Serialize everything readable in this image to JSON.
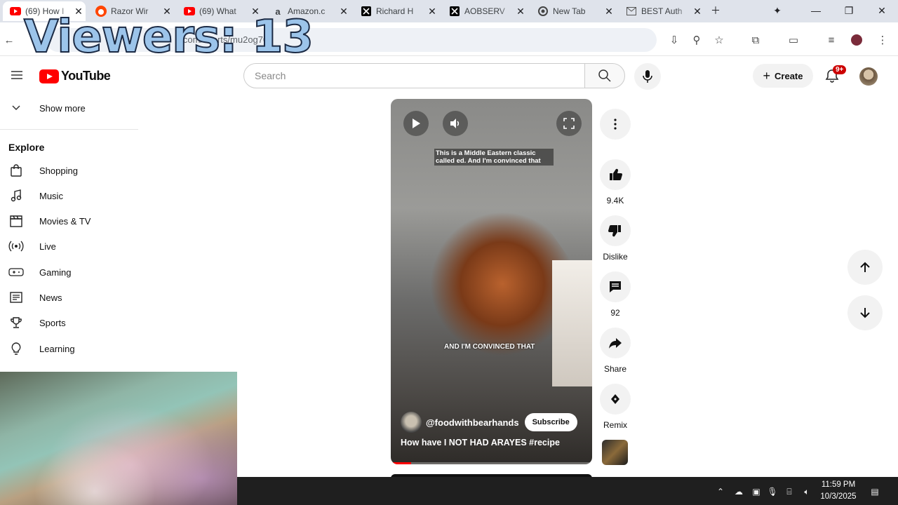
{
  "browser": {
    "tabs": [
      {
        "title": "(69) How I",
        "favicon": "youtube",
        "active": true
      },
      {
        "title": "Razor Wir",
        "favicon": "reddit",
        "active": false
      },
      {
        "title": "(69) What",
        "favicon": "youtube",
        "active": false
      },
      {
        "title": "Amazon.c",
        "favicon": "amazon",
        "active": false
      },
      {
        "title": "Richard H",
        "favicon": "x",
        "active": false
      },
      {
        "title": "AOBSERV",
        "favicon": "x",
        "active": false
      },
      {
        "title": "New Tab",
        "favicon": "chrome",
        "active": false
      },
      {
        "title": "BEST Auth",
        "favicon": "gmail",
        "active": false
      }
    ],
    "url": "e.com/shorts/mu2og70"
  },
  "overlay": {
    "viewers_text": "Viewers: 13"
  },
  "youtube": {
    "logo_text": "YouTube",
    "search_placeholder": "Search",
    "create_label": "Create",
    "notification_count": "9+",
    "sidebar": {
      "show_more": "Show more",
      "explore_title": "Explore",
      "items": [
        {
          "label": "Shopping",
          "icon": "shopping-bag-icon"
        },
        {
          "label": "Music",
          "icon": "music-note-icon"
        },
        {
          "label": "Movies & TV",
          "icon": "clapperboard-icon"
        },
        {
          "label": "Live",
          "icon": "live-broadcast-icon"
        },
        {
          "label": "Gaming",
          "icon": "gamepad-icon"
        },
        {
          "label": "News",
          "icon": "newspaper-icon"
        },
        {
          "label": "Sports",
          "icon": "trophy-icon"
        },
        {
          "label": "Learning",
          "icon": "lightbulb-icon"
        }
      ]
    },
    "short": {
      "caption_top": "This is a Middle Eastern classic called ed. And I'm convinced that",
      "caption_mid": "AND I'M CONVINCED THAT",
      "channel": "@foodwithbearhands",
      "subscribe_label": "Subscribe",
      "title": "How have I NOT HAD ARAYES #recipe",
      "progress_fraction": 0.1
    },
    "actions": {
      "likes": "9.4K",
      "dislike_label": "Dislike",
      "comments": "92",
      "share_label": "Share",
      "remix_label": "Remix"
    }
  },
  "taskbar": {
    "time": "11:59 PM",
    "date": "10/3/2025"
  },
  "colors": {
    "brand_red": "#ff0000",
    "taskbar": "#1f1f1f",
    "tabstrip": "#dfe3eb"
  }
}
